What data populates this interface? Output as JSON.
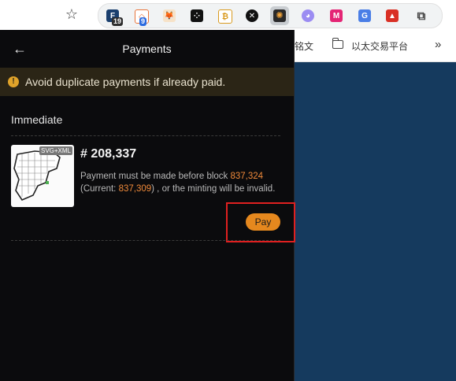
{
  "browser": {
    "extensions": [
      {
        "name": "ext-f-icon",
        "badge": "19",
        "color": "#1a3f6e"
      },
      {
        "name": "ext-loop-icon",
        "badge": "9",
        "color": "#e8743b"
      },
      {
        "name": "metamask-icon",
        "color": "#e2761b"
      },
      {
        "name": "ext-dice-icon",
        "color": "#111111"
      },
      {
        "name": "ext-bitcoin-icon",
        "color": "#d99a1e"
      },
      {
        "name": "ext-x-icon",
        "color": "#111111"
      },
      {
        "name": "ext-unisat-icon",
        "color": "#2a2a2a"
      },
      {
        "name": "ext-ghost-icon",
        "color": "#9b8cf2"
      },
      {
        "name": "ext-me-icon",
        "color": "#e42575"
      },
      {
        "name": "translate-icon",
        "color": "#4a7ee6"
      },
      {
        "name": "ext-red-icon",
        "color": "#d93025"
      },
      {
        "name": "extensions-puzzle-icon",
        "color": "#444444"
      }
    ],
    "bookmarks": {
      "item1": "铭文",
      "item2": "以太交易平台",
      "more": "»"
    }
  },
  "panel": {
    "title": "Payments",
    "warning": "Avoid duplicate payments if already paid.",
    "section": "Immediate",
    "item": {
      "thumb_badge": "SVG+XML",
      "number": "# 208,337",
      "desc_prefix": "Payment must be made before block ",
      "block": "837,324",
      "current_prefix": "(Current: ",
      "current": "837,309",
      "desc_suffix": ") , or the minting will be invalid.",
      "pay_label": "Pay"
    }
  }
}
